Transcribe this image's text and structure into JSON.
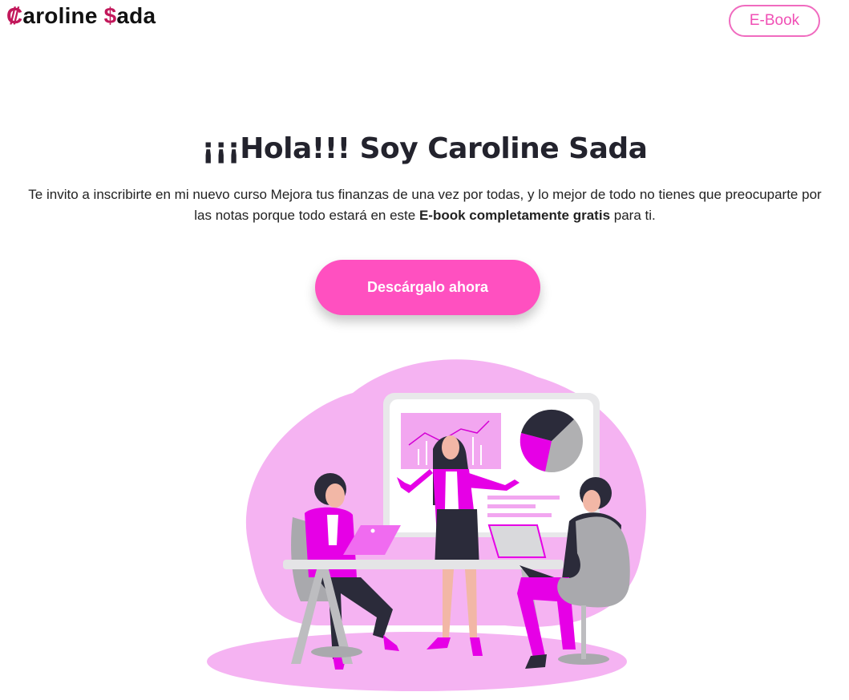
{
  "header": {
    "logo_first_initial": "₡",
    "logo_first_rest": "aroline ",
    "logo_last_initial": "$",
    "logo_last_rest": "ada",
    "ebook_label": "E-Book"
  },
  "hero": {
    "title": "¡¡¡Hola!!! Soy Caroline Sada",
    "text_part1": "Te invito a inscribirte en mi nuevo curso Mejora tus finanzas de una vez por todas, y lo mejor de todo no tienes que preocuparte por las notas porque todo estará en este ",
    "text_bold": "E-book completamente gratis",
    "text_part2": " para ti.",
    "cta_label": "Descárgalo ahora"
  },
  "colors": {
    "accent": "#ff50c0",
    "logo_accent": "#c2185b",
    "blob": "#f5b3f2",
    "magenta": "#e600e6"
  },
  "illustration": {
    "name": "business-meeting-illustration"
  }
}
